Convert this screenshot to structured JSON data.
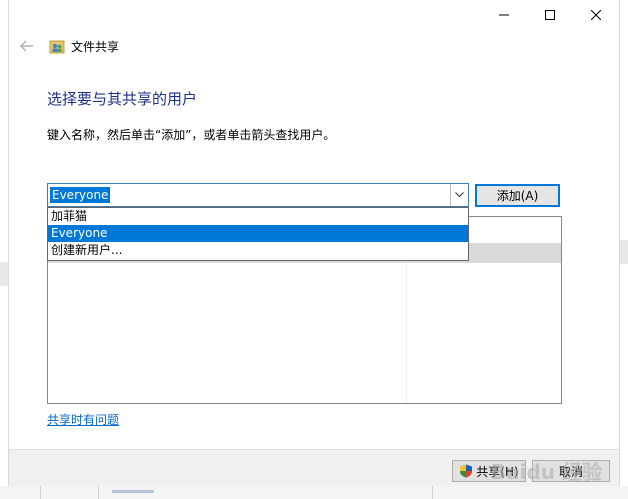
{
  "window": {
    "title": "文件共享",
    "controls": {
      "minimize": "minimize-icon",
      "maximize": "maximize-icon",
      "close": "close-icon"
    }
  },
  "page": {
    "heading": "选择要与其共享的用户",
    "instruction": "键入名称，然后单击“添加”，或者单击箭头查找用户。"
  },
  "combo": {
    "value": "Everyone",
    "options": [
      "加菲猫",
      "Everyone",
      "创建新用户..."
    ],
    "selected_index": 1
  },
  "buttons": {
    "add": "添加(A)",
    "share": "共享(H)",
    "cancel": "取消"
  },
  "help_link": "共享时有问题",
  "watermark": "Baidu 经验",
  "colors": {
    "accent": "#0078d7",
    "heading": "#1e3287",
    "link": "#0066cc"
  }
}
